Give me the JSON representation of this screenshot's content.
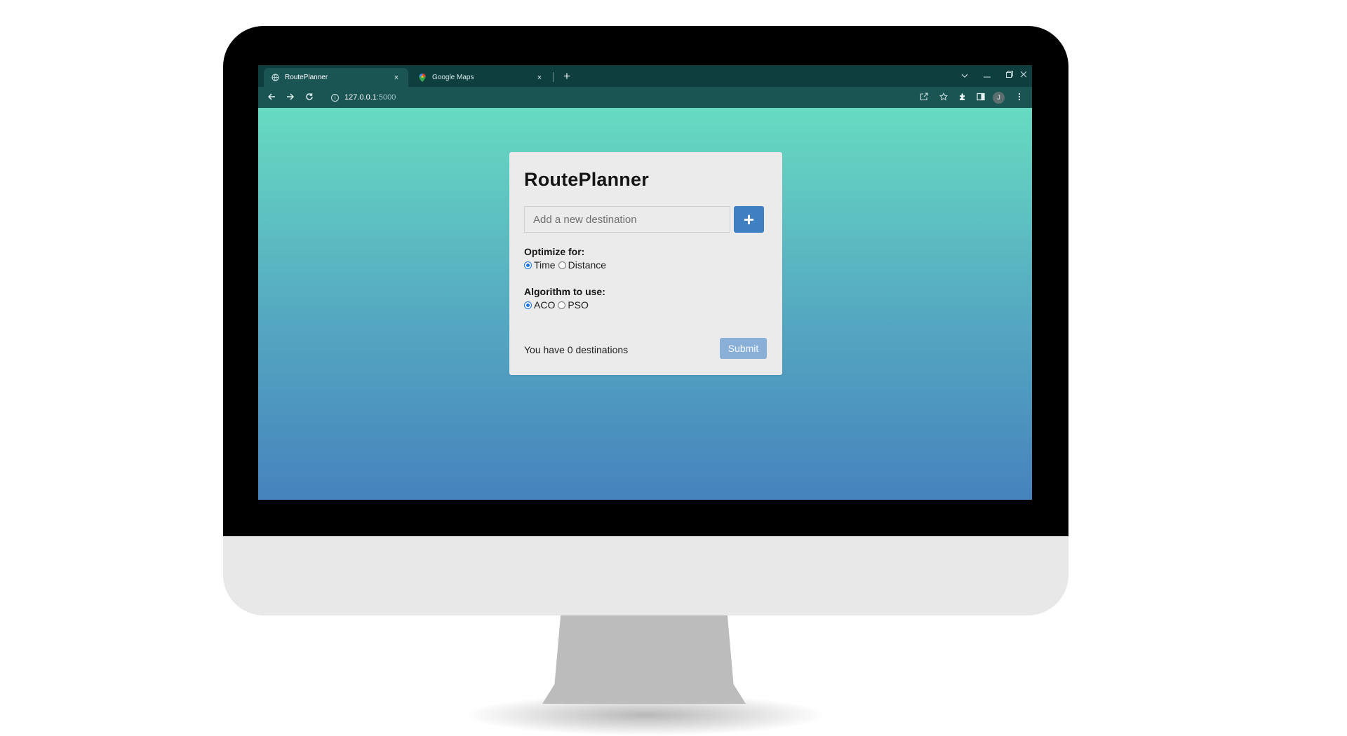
{
  "browser": {
    "tabs": [
      {
        "title": "RoutePlanner",
        "active": true
      },
      {
        "title": "Google Maps",
        "active": false
      }
    ],
    "tab_close": "×",
    "new_tab": "+",
    "url_host": "127.0.0.1",
    "url_port": ":5000",
    "avatar_initial": "J"
  },
  "app": {
    "title": "RoutePlanner",
    "destination_placeholder": "Add a new destination",
    "add_label": "+",
    "optimize_label": "Optimize for:",
    "optimize_options": [
      "Time",
      "Distance"
    ],
    "optimize_selected": "Time",
    "algorithm_label": "Algorithm to use:",
    "algorithm_options": [
      "ACO",
      "PSO"
    ],
    "algorithm_selected": "ACO",
    "destination_count_text": "You have 0 destinations",
    "submit_label": "Submit"
  },
  "colors": {
    "gradient_top": "#67dbc1",
    "gradient_bottom": "#4683bd",
    "accent": "#3f80c2",
    "submit_disabled": "#8bb0d8",
    "browser_frame": "#0f3e3e"
  }
}
